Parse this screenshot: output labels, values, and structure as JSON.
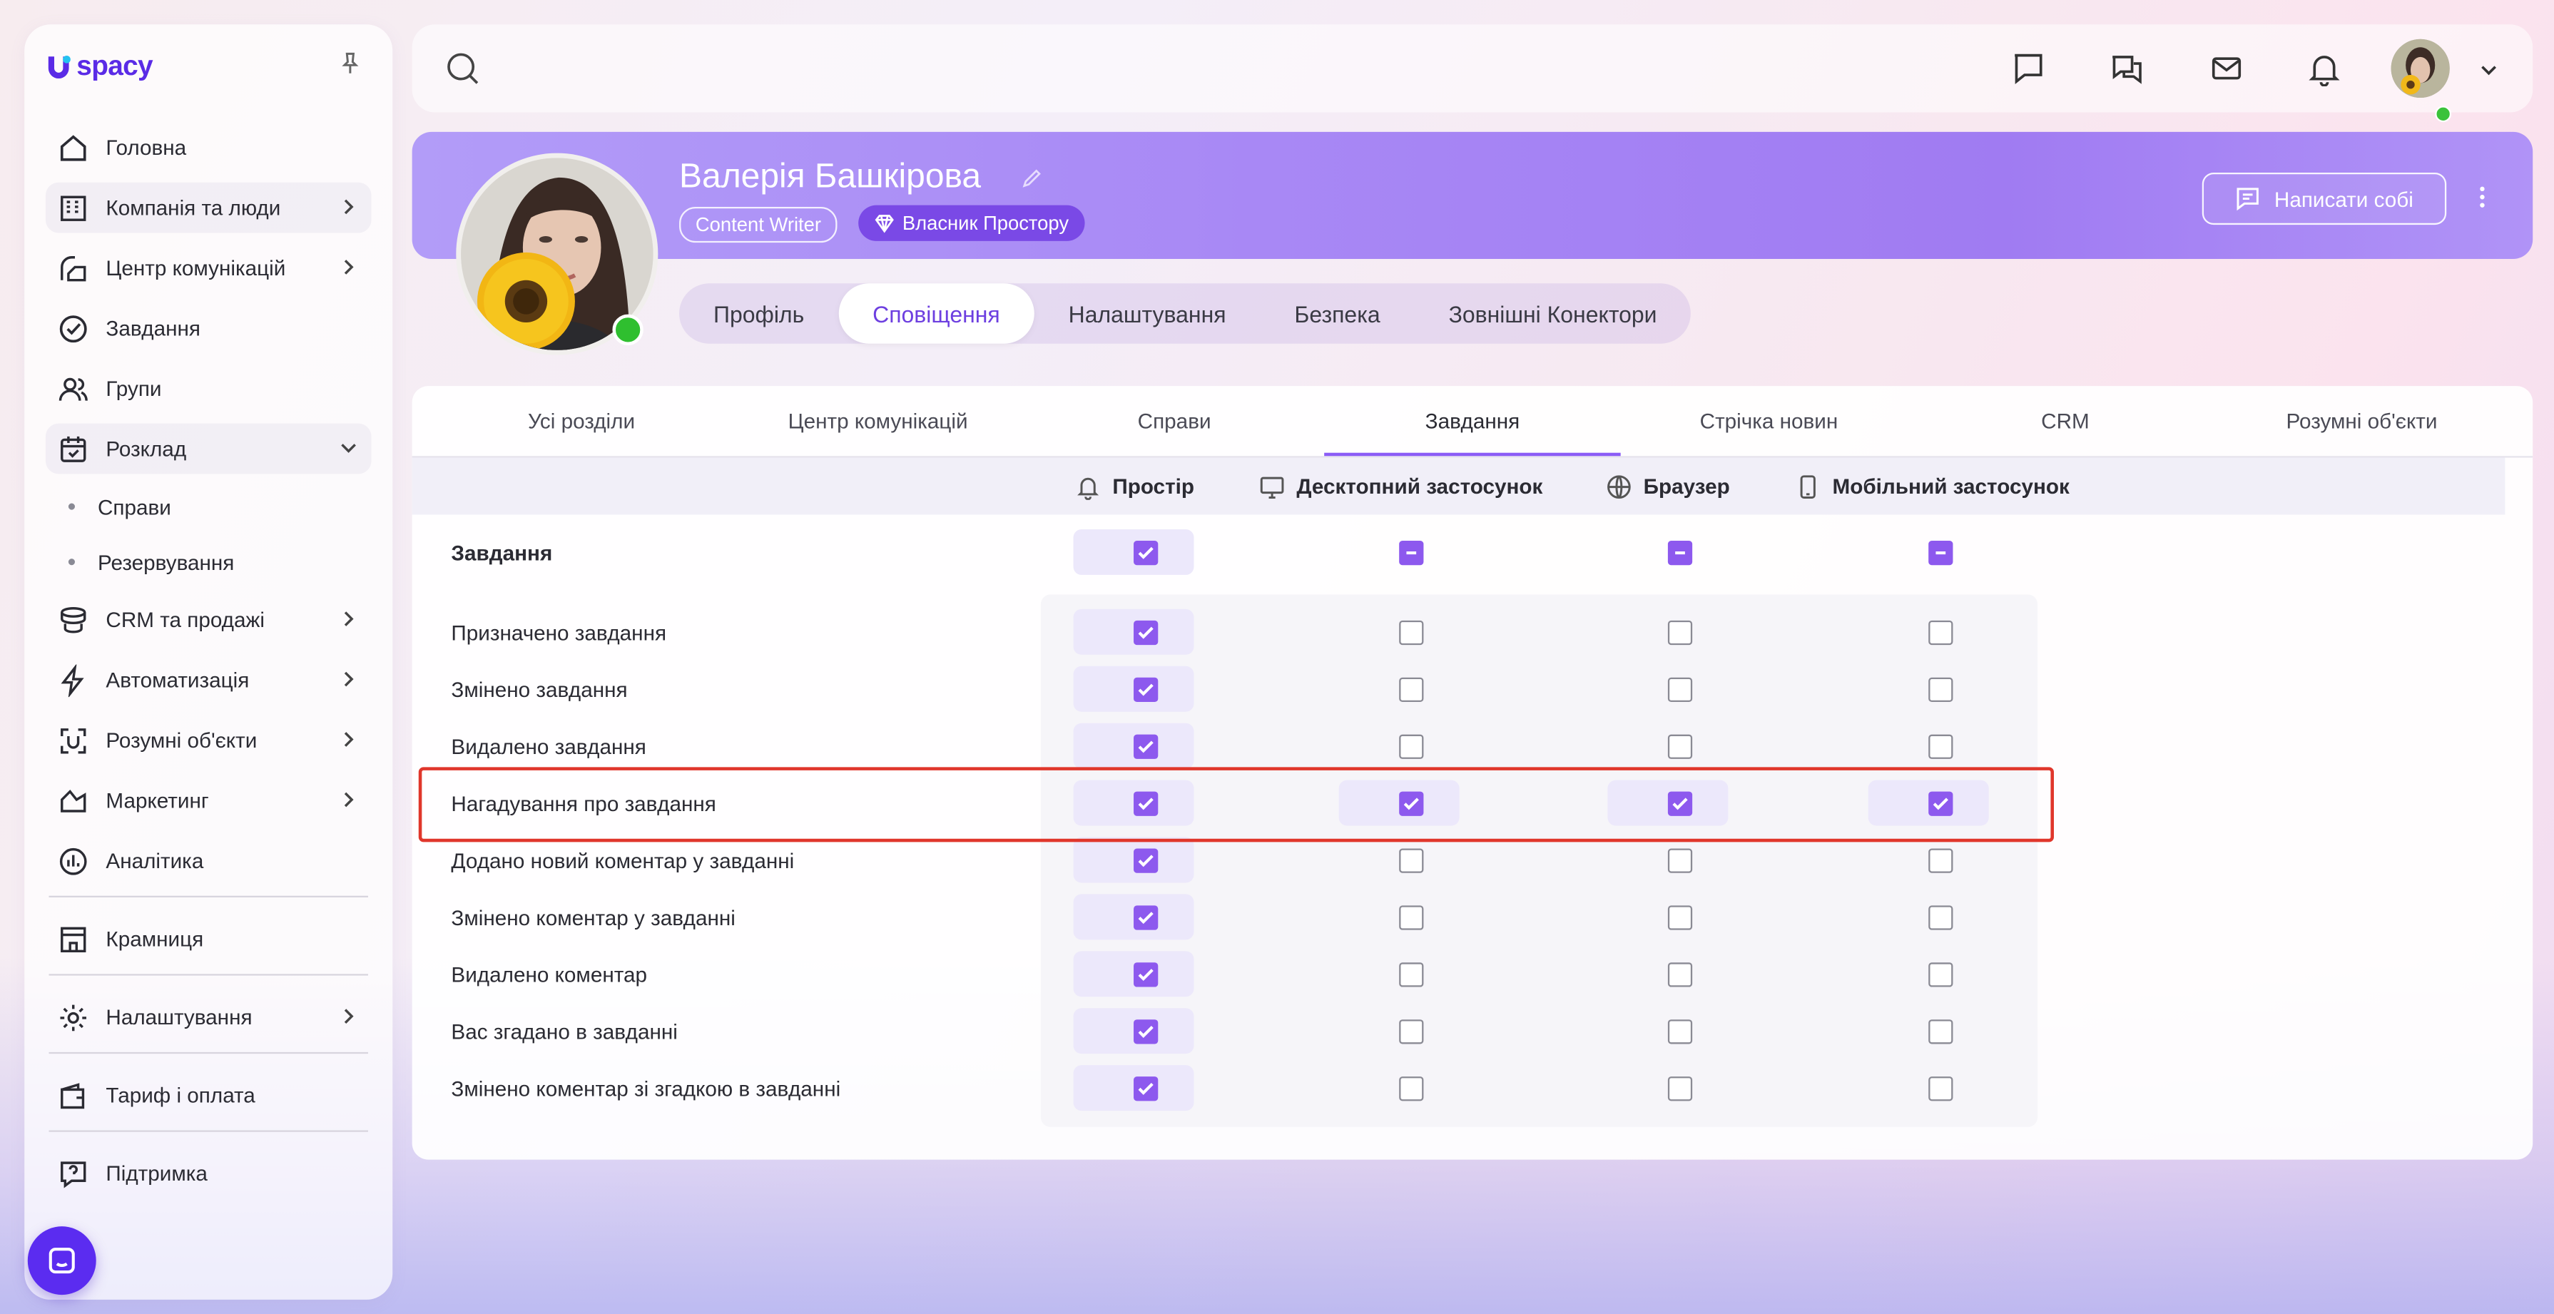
{
  "app": {
    "logo_text": "spacy"
  },
  "sidebar": {
    "items": [
      {
        "label": "Головна"
      },
      {
        "label": "Компанія та люди"
      },
      {
        "label": "Центр комунікацій"
      },
      {
        "label": "Завдання"
      },
      {
        "label": "Групи"
      },
      {
        "label": "Розклад"
      },
      {
        "label": "CRM та продажі"
      },
      {
        "label": "Автоматизація"
      },
      {
        "label": "Розумні об'єкти"
      },
      {
        "label": "Маркетинг"
      },
      {
        "label": "Аналітика"
      },
      {
        "label": "Крамниця"
      },
      {
        "label": "Налаштування"
      },
      {
        "label": "Тариф і оплата"
      },
      {
        "label": "Підтримка"
      }
    ],
    "schedule_sub": [
      {
        "label": "Справи"
      },
      {
        "label": "Резервування"
      }
    ]
  },
  "profile": {
    "name": "Валерія Башкірова",
    "position_badge": "Content Writer",
    "owner_badge": "Власник Простору",
    "write_button": "Написати собі",
    "tabs": [
      {
        "label": "Профіль"
      },
      {
        "label": "Сповіщення"
      },
      {
        "label": "Налаштування"
      },
      {
        "label": "Безпека"
      },
      {
        "label": "Зовнішні Конектори"
      }
    ],
    "active_tab": "Сповіщення"
  },
  "notifications": {
    "section_tabs": [
      {
        "label": "Усі розділи"
      },
      {
        "label": "Центр комунікацій"
      },
      {
        "label": "Справи"
      },
      {
        "label": "Завдання"
      },
      {
        "label": "Стрічка новин"
      },
      {
        "label": "CRM"
      },
      {
        "label": "Розумні об'єкти"
      }
    ],
    "active_section": "Завдання",
    "columns": [
      {
        "label": "Простір",
        "icon": "bell-icon"
      },
      {
        "label": "Десктопний застосунок",
        "icon": "monitor-icon"
      },
      {
        "label": "Браузер",
        "icon": "globe-icon"
      },
      {
        "label": "Мобільний застосунок",
        "icon": "phone-icon"
      }
    ],
    "group": {
      "label": "Завдання",
      "states": [
        "checked",
        "mixed",
        "mixed",
        "mixed"
      ]
    },
    "rows": [
      {
        "label": "Призначено завдання",
        "states": [
          true,
          false,
          false,
          false
        ]
      },
      {
        "label": "Змінено завдання",
        "states": [
          true,
          false,
          false,
          false
        ]
      },
      {
        "label": "Видалено завдання",
        "states": [
          true,
          false,
          false,
          false
        ]
      },
      {
        "label": "Нагадування про завдання",
        "states": [
          true,
          true,
          true,
          true
        ],
        "highlighted": true
      },
      {
        "label": "Додано новий коментар у завданні",
        "states": [
          true,
          false,
          false,
          false
        ]
      },
      {
        "label": "Змінено коментар у завданні",
        "states": [
          true,
          false,
          false,
          false
        ]
      },
      {
        "label": "Видалено коментар",
        "states": [
          true,
          false,
          false,
          false
        ]
      },
      {
        "label": "Вас згадано в завданні",
        "states": [
          true,
          false,
          false,
          false
        ]
      },
      {
        "label": "Змінено коментар зі згадкою в завданні",
        "states": [
          true,
          false,
          false,
          false
        ]
      }
    ]
  },
  "colors": {
    "accent": "#8d59ee",
    "brand": "#5a2be6",
    "highlight": "#e0362b",
    "status_online": "#2fbf2f"
  }
}
